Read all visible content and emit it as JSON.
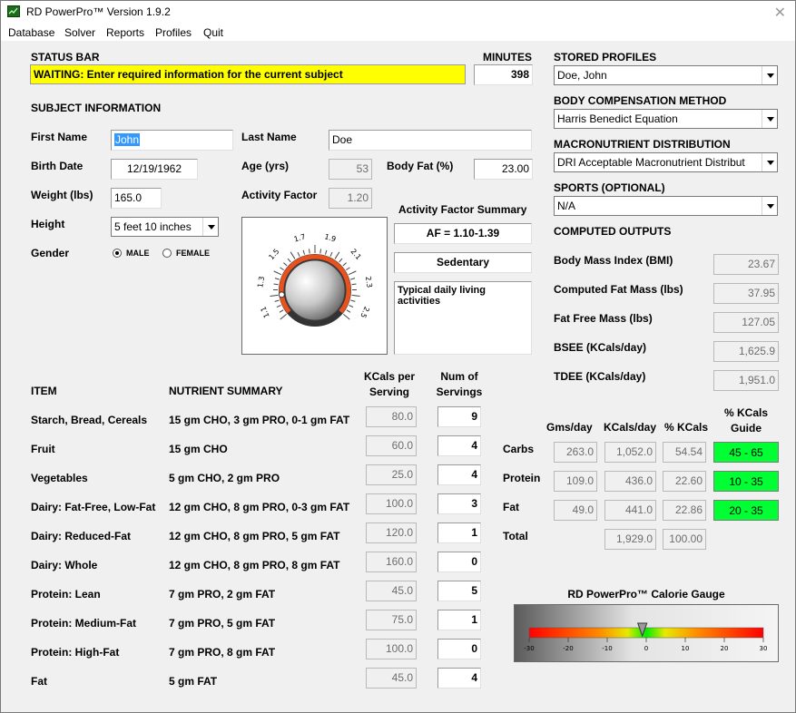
{
  "window": {
    "title": "RD PowerPro™ Version 1.9.2",
    "close_glyph": "✕"
  },
  "menu": [
    "Database",
    "Solver",
    "Reports",
    "Profiles",
    "Quit"
  ],
  "status": {
    "label": "STATUS BAR",
    "message": "WAITING: Enter required information for the current subject"
  },
  "minutes": {
    "label": "MINUTES",
    "value": "398"
  },
  "subject": {
    "heading": "SUBJECT INFORMATION",
    "first_name_label": "First Name",
    "first_name": "John",
    "last_name_label": "Last Name",
    "last_name": "Doe",
    "birth_date_label": "Birth Date",
    "birth_date": "12/19/1962",
    "age_label": "Age (yrs)",
    "age": "53",
    "body_fat_label": "Body Fat (%)",
    "body_fat": "23.00",
    "weight_label": "Weight (lbs)",
    "weight": "165.0",
    "activity_label": "Activity Factor",
    "activity": "1.20",
    "height_label": "Height",
    "height": "5 feet 10 inches",
    "gender_label": "Gender",
    "male": "MALE",
    "female": "FEMALE",
    "gender_selected": "male"
  },
  "activity_dial": {
    "ticks": [
      "1.1",
      "1.3",
      "1.5",
      "1.7",
      "1.9",
      "2.1",
      "2.3",
      "2.5"
    ],
    "value": 1.2,
    "min": 1.0,
    "max": 2.6
  },
  "activity_summary": {
    "heading": "Activity Factor Summary",
    "range": "AF = 1.10-1.39",
    "level": "Sedentary",
    "description": "Typical daily living activities"
  },
  "profiles": {
    "label": "STORED PROFILES",
    "selected": "Doe, John"
  },
  "body_comp": {
    "label": "BODY COMPENSATION METHOD",
    "selected": "Harris Benedict Equation"
  },
  "macro": {
    "label": "MACRONUTRIENT DISTRIBUTION",
    "selected": "DRI Acceptable Macronutrient Distribut"
  },
  "sports": {
    "label": "SPORTS (OPTIONAL)",
    "selected": "N/A"
  },
  "outputs": {
    "heading": "COMPUTED OUTPUTS",
    "rows": [
      {
        "label": "Body Mass Index (BMI)",
        "value": "23.67"
      },
      {
        "label": "Computed Fat Mass (lbs)",
        "value": "37.95"
      },
      {
        "label": "Fat Free Mass (lbs)",
        "value": "127.05"
      },
      {
        "label": "BSEE (KCals/day)",
        "value": "1,625.9"
      },
      {
        "label": "TDEE (KCals/day)",
        "value": "1,951.0"
      }
    ]
  },
  "items": {
    "col_item": "ITEM",
    "col_summary": "NUTRIENT SUMMARY",
    "col_kcals_1": "KCals per",
    "col_kcals_2": "Serving",
    "col_servings_1": "Num of",
    "col_servings_2": "Servings",
    "rows": [
      {
        "item": "Starch, Bread, Cereals",
        "summary": "15 gm CHO, 3 gm PRO, 0-1 gm FAT",
        "kcals": "80.0",
        "servings": "9"
      },
      {
        "item": "Fruit",
        "summary": "15 gm CHO",
        "kcals": "60.0",
        "servings": "4"
      },
      {
        "item": "Vegetables",
        "summary": "5 gm CHO, 2 gm PRO",
        "kcals": "25.0",
        "servings": "4"
      },
      {
        "item": "Dairy: Fat-Free, Low-Fat",
        "summary": "12 gm CHO, 8 gm PRO, 0-3 gm FAT",
        "kcals": "100.0",
        "servings": "3"
      },
      {
        "item": "Dairy: Reduced-Fat",
        "summary": "12 gm CHO, 8 gm PRO, 5 gm FAT",
        "kcals": "120.0",
        "servings": "1"
      },
      {
        "item": "Dairy: Whole",
        "summary": "12 gm CHO, 8 gm PRO, 8 gm FAT",
        "kcals": "160.0",
        "servings": "0"
      },
      {
        "item": "Protein: Lean",
        "summary": "7 gm PRO, 2 gm FAT",
        "kcals": "45.0",
        "servings": "5"
      },
      {
        "item": "Protein: Medium-Fat",
        "summary": "7 gm PRO, 5 gm FAT",
        "kcals": "75.0",
        "servings": "1"
      },
      {
        "item": "Protein: High-Fat",
        "summary": "7 gm PRO, 8 gm FAT",
        "kcals": "100.0",
        "servings": "0"
      },
      {
        "item": "Fat",
        "summary": "5 gm FAT",
        "kcals": "45.0",
        "servings": "4"
      }
    ]
  },
  "macros": {
    "col_gms": "Gms/day",
    "col_kcals": "KCals/day",
    "col_pct": "% KCals",
    "col_guide_1": "% KCals",
    "col_guide_2": "Guide",
    "rows": [
      {
        "name": "Carbs",
        "gms": "263.0",
        "kcals": "1,052.0",
        "pct": "54.54",
        "guide": "45 - 65"
      },
      {
        "name": "Protein",
        "gms": "109.0",
        "kcals": "436.0",
        "pct": "22.60",
        "guide": "10 - 35"
      },
      {
        "name": "Fat",
        "gms": "49.0",
        "kcals": "441.0",
        "pct": "22.86",
        "guide": "20 - 35"
      }
    ],
    "total_label": "Total",
    "total_kcals": "1,929.0",
    "total_pct": "100.00",
    "guide_color": "#00ff33"
  },
  "gauge": {
    "title": "RD PowerPro™ Calorie Gauge",
    "ticks": [
      "-30",
      "-20",
      "-10",
      "0",
      "10",
      "20",
      "30"
    ],
    "min": -30,
    "max": 30,
    "value": -1
  }
}
